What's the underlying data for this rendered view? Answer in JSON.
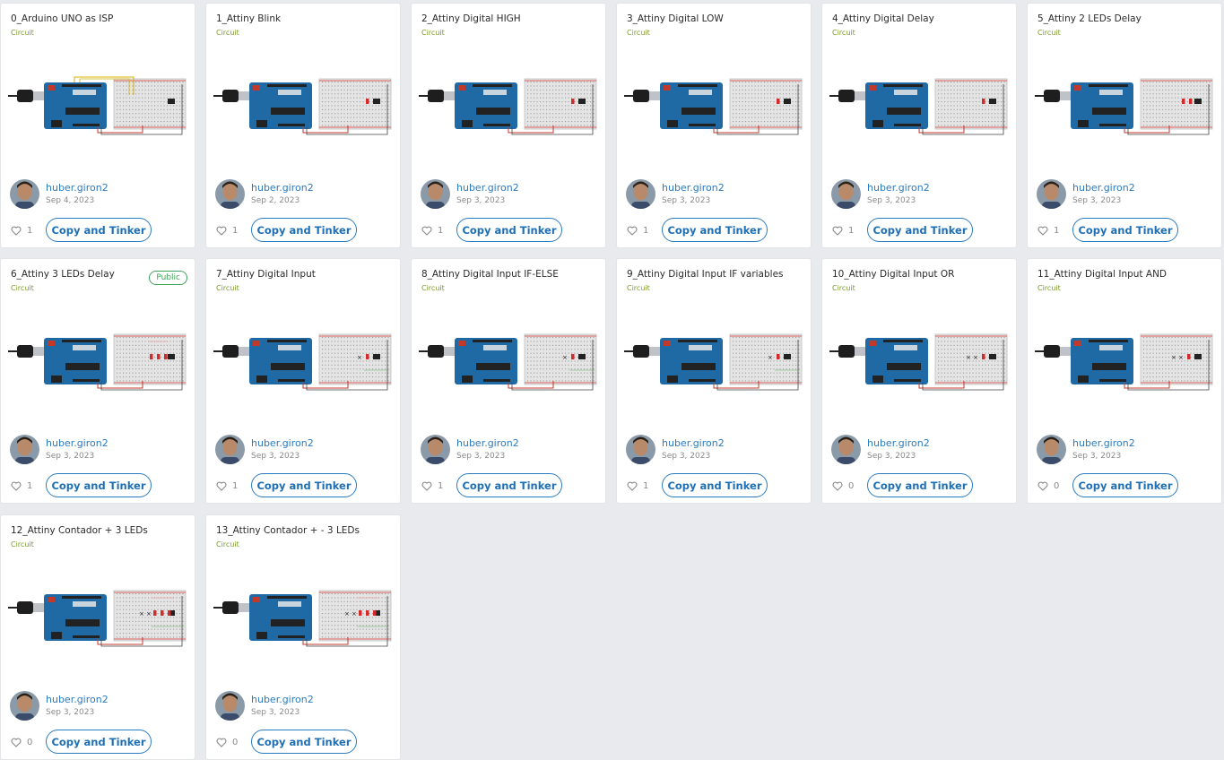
{
  "labels": {
    "type": "Circuit",
    "copy": "Copy and Tinker"
  },
  "colors": {
    "accent": "#2b7bc0",
    "public": "#3fa15a",
    "circuit_label": "#7a9a2a"
  },
  "cards": [
    {
      "title": "0_Arduino UNO as ISP",
      "author": "huber.giron2",
      "date": "Sep 4, 2023",
      "likes": "1",
      "variant": "isp"
    },
    {
      "title": "1_Attiny Blink",
      "author": "huber.giron2",
      "date": "Sep 2, 2023",
      "likes": "1",
      "variant": "led1"
    },
    {
      "title": "2_Attiny Digital HIGH",
      "author": "huber.giron2",
      "date": "Sep 3, 2023",
      "likes": "1",
      "variant": "led1"
    },
    {
      "title": "3_Attiny Digital LOW",
      "author": "huber.giron2",
      "date": "Sep 3, 2023",
      "likes": "1",
      "variant": "led1"
    },
    {
      "title": "4_Attiny Digital Delay",
      "author": "huber.giron2",
      "date": "Sep 3, 2023",
      "likes": "1",
      "variant": "led1"
    },
    {
      "title": "5_Attiny 2 LEDs Delay",
      "author": "huber.giron2",
      "date": "Sep 3, 2023",
      "likes": "1",
      "variant": "led2"
    },
    {
      "title": "6_Attiny 3 LEDs Delay",
      "author": "huber.giron2",
      "date": "Sep 3, 2023",
      "likes": "1",
      "variant": "led3",
      "badge": "Public"
    },
    {
      "title": "7_Attiny Digital Input",
      "author": "huber.giron2",
      "date": "Sep 3, 2023",
      "likes": "1",
      "variant": "btn1"
    },
    {
      "title": "8_Attiny Digital Input IF-ELSE",
      "author": "huber.giron2",
      "date": "Sep 3, 2023",
      "likes": "1",
      "variant": "btn1"
    },
    {
      "title": "9_Attiny Digital Input IF variables",
      "author": "huber.giron2",
      "date": "Sep 3, 2023",
      "likes": "1",
      "variant": "btn1"
    },
    {
      "title": "10_Attiny Digital Input OR",
      "author": "huber.giron2",
      "date": "Sep 3, 2023",
      "likes": "0",
      "variant": "btn2"
    },
    {
      "title": "11_Attiny Digital Input AND",
      "author": "huber.giron2",
      "date": "Sep 3, 2023",
      "likes": "0",
      "variant": "btn2"
    },
    {
      "title": "12_Attiny Contador + 3 LEDs",
      "author": "huber.giron2",
      "date": "Sep 3, 2023",
      "likes": "0",
      "variant": "cnt"
    },
    {
      "title": "13_Attiny Contador + - 3 LEDs",
      "author": "huber.giron2",
      "date": "Sep 3, 2023",
      "likes": "0",
      "variant": "cnt"
    }
  ]
}
